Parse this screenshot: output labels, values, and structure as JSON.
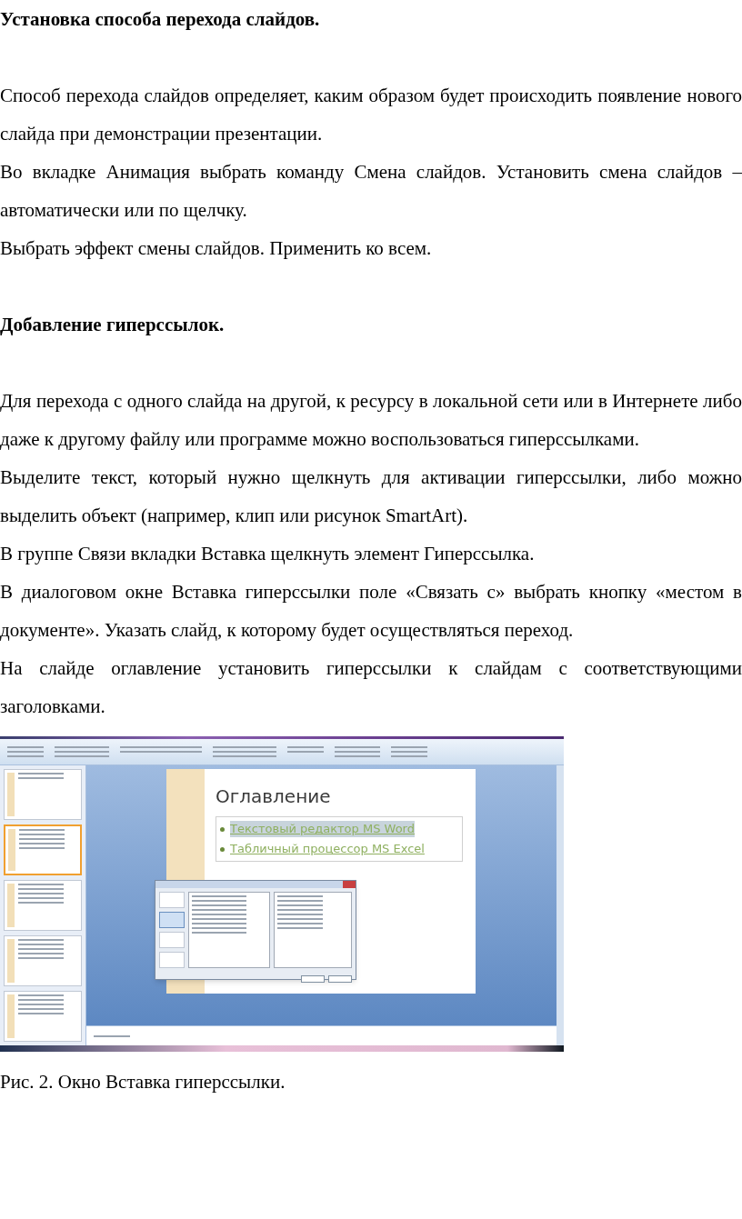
{
  "paragraphs": [
    {
      "kind": "heading",
      "text": "Установка способа перехода слайдов."
    },
    {
      "kind": "text",
      "text": "Способ перехода слайдов определяет, каким образом будет происходить появление нового слайда при демонстрации презентации."
    },
    {
      "kind": "text",
      "text": "Во вкладке Анимация выбрать команду Смена слайдов. Установить смена слайдов – автоматически или по щелчку."
    },
    {
      "kind": "text",
      "text": "Выбрать эффект смены слайдов. Применить ко всем."
    },
    {
      "kind": "heading",
      "text": "Добавление гиперссылок."
    },
    {
      "kind": "text",
      "text": "Для перехода с одного слайда на другой, к ресурсу в локальной сети или в Интернете либо даже к другому файлу или программе можно воспользоваться гиперссылками."
    },
    {
      "kind": "text",
      "text": "Выделите текст, который нужно щелкнуть для активации гиперссылки, либо можно выделить объект (например, клип или рисунок SmartArt)."
    },
    {
      "kind": "text",
      "text": "В группе Связи вкладки Вставка щелкнуть элемент Гиперссылка."
    },
    {
      "kind": "text",
      "text": "В диалоговом окне Вставка гиперссылки поле  «Связать с» выбрать кнопку «местом в документе». Указать слайд, к которому будет осуществляться переход."
    },
    {
      "kind": "text",
      "text": "На слайде оглавление установить гиперссылки к слайдам с соответствующими заголовками."
    }
  ],
  "figure": {
    "slide_title": "Оглавление",
    "links": [
      {
        "text": "Текстовый редактор MS Word",
        "selected": true
      },
      {
        "text": "Табличный процессор MS Excel",
        "selected": false
      }
    ]
  },
  "caption": "Рис. 2. Окно Вставка гиперссылки."
}
